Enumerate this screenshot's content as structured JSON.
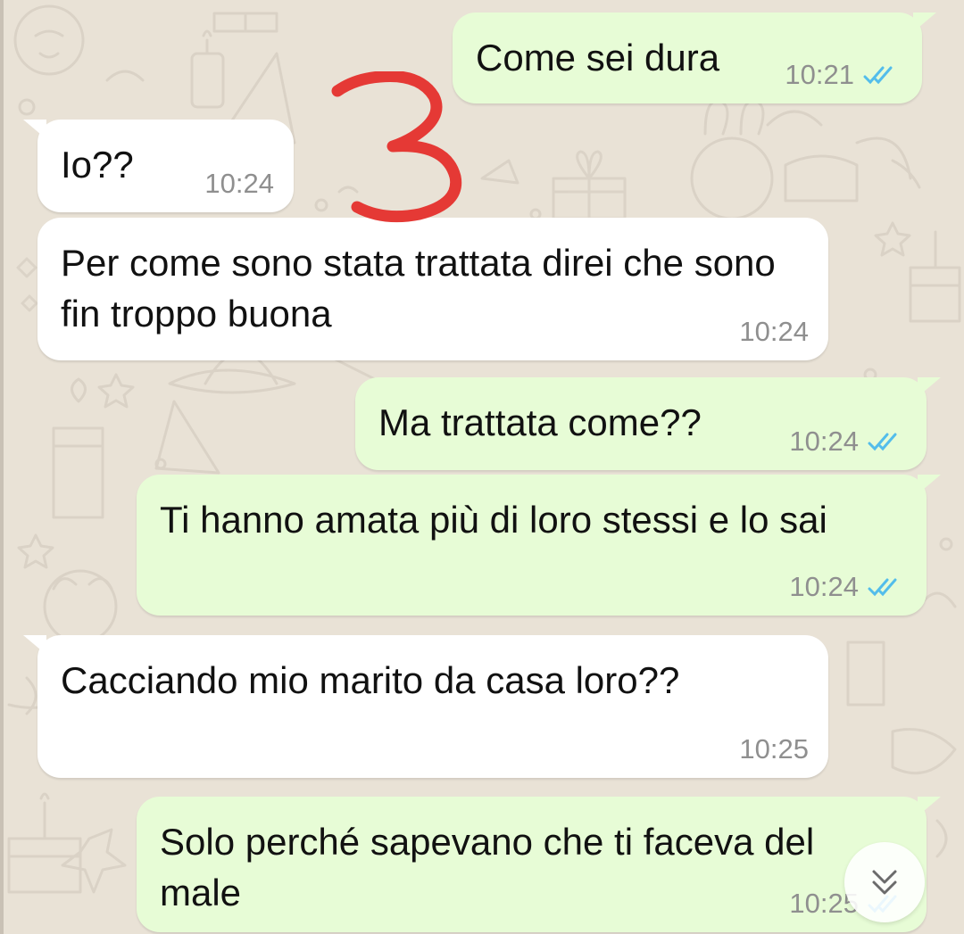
{
  "colors": {
    "outgoing_bubble": "#e7fcd6",
    "incoming_bubble": "#ffffff",
    "wallpaper": "#e9e2d6",
    "timestamp": "#8f8f8f",
    "read_ticks": "#53bdeb",
    "annotation": "#e53935"
  },
  "annotation": {
    "label": "3"
  },
  "messages": [
    {
      "direction": "out",
      "text": "Come sei dura",
      "time": "10:21",
      "status": "read"
    },
    {
      "direction": "in",
      "text": "Io??",
      "time": "10:24"
    },
    {
      "direction": "in",
      "text": "Per come sono stata trattata direi che sono fin troppo buona",
      "time": "10:24"
    },
    {
      "direction": "out",
      "text": "Ma trattata come??",
      "time": "10:24",
      "status": "read"
    },
    {
      "direction": "out",
      "text": "Ti hanno amata più di loro stessi e lo sai",
      "time": "10:24",
      "status": "read"
    },
    {
      "direction": "in",
      "text": "Cacciando mio marito da casa loro??",
      "time": "10:25"
    },
    {
      "direction": "out",
      "text": "Solo perché sapevano che ti faceva del male",
      "time": "10:25",
      "status": "read"
    }
  ],
  "scroll_button": {
    "icon": "double-chevron-down-icon"
  }
}
